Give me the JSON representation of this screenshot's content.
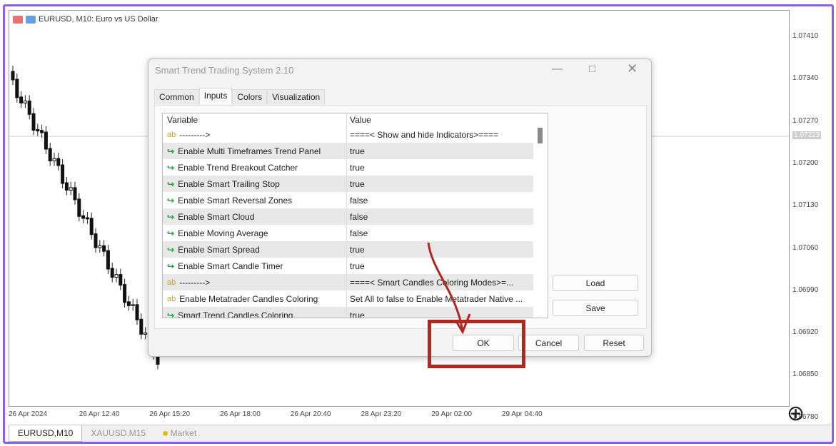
{
  "chart": {
    "symbol_title": "EURUSD, M10:  Euro vs US Dollar",
    "prices": [
      "1.07410",
      "1.07340",
      "1.07270",
      "1.07200",
      "1.07130",
      "1.07060",
      "1.06990",
      "1.06920",
      "1.06850",
      "1.06780"
    ],
    "current_price": "1.07223",
    "times": [
      "26 Apr 2024",
      "26 Apr 12:40",
      "26 Apr 15:20",
      "26 Apr 18:00",
      "26 Apr 20:40",
      "28 Apr 23:20",
      "29 Apr 02:00",
      "29 Apr 04:40"
    ]
  },
  "bottom_tabs": [
    "EURUSD,M10",
    "XAUUSD,M15",
    "Market"
  ],
  "dialog": {
    "title": "Smart Trend Trading System 2.10",
    "tabs": [
      "Common",
      "Inputs",
      "Colors",
      "Visualization"
    ],
    "columns": [
      "Variable",
      "Value"
    ],
    "rows": [
      {
        "icon": "ab",
        "variable": "--------->",
        "value": "====< Show and hide Indicators>===="
      },
      {
        "icon": "arrow",
        "variable": "Enable Multi Timeframes Trend Panel",
        "value": "true"
      },
      {
        "icon": "arrow",
        "variable": "Enable Trend Breakout Catcher",
        "value": "true"
      },
      {
        "icon": "arrow",
        "variable": "Enable Smart Trailing Stop",
        "value": "true"
      },
      {
        "icon": "arrow",
        "variable": "Enable Smart Reversal Zones",
        "value": "false"
      },
      {
        "icon": "arrow",
        "variable": "Enable Smart Cloud",
        "value": "false"
      },
      {
        "icon": "arrow",
        "variable": "Enable Moving Average",
        "value": "false"
      },
      {
        "icon": "arrow",
        "variable": "Enable Smart Spread",
        "value": "true"
      },
      {
        "icon": "arrow",
        "variable": "Enable Smart Candle Timer",
        "value": "true"
      },
      {
        "icon": "ab",
        "variable": "--------->",
        "value": "====< Smart Candles Coloring Modes>=..."
      },
      {
        "icon": "ab",
        "variable": "Enable Metatrader Candles Coloring",
        "value": "Set All to false to Enable Metatrader Native ..."
      },
      {
        "icon": "arrow",
        "variable": "Smart Trend Candles Coloring",
        "value": "true"
      }
    ],
    "load": "Load",
    "save": "Save",
    "ok": "OK",
    "cancel": "Cancel",
    "reset": "Reset"
  },
  "annotation_color": "#b3261e"
}
